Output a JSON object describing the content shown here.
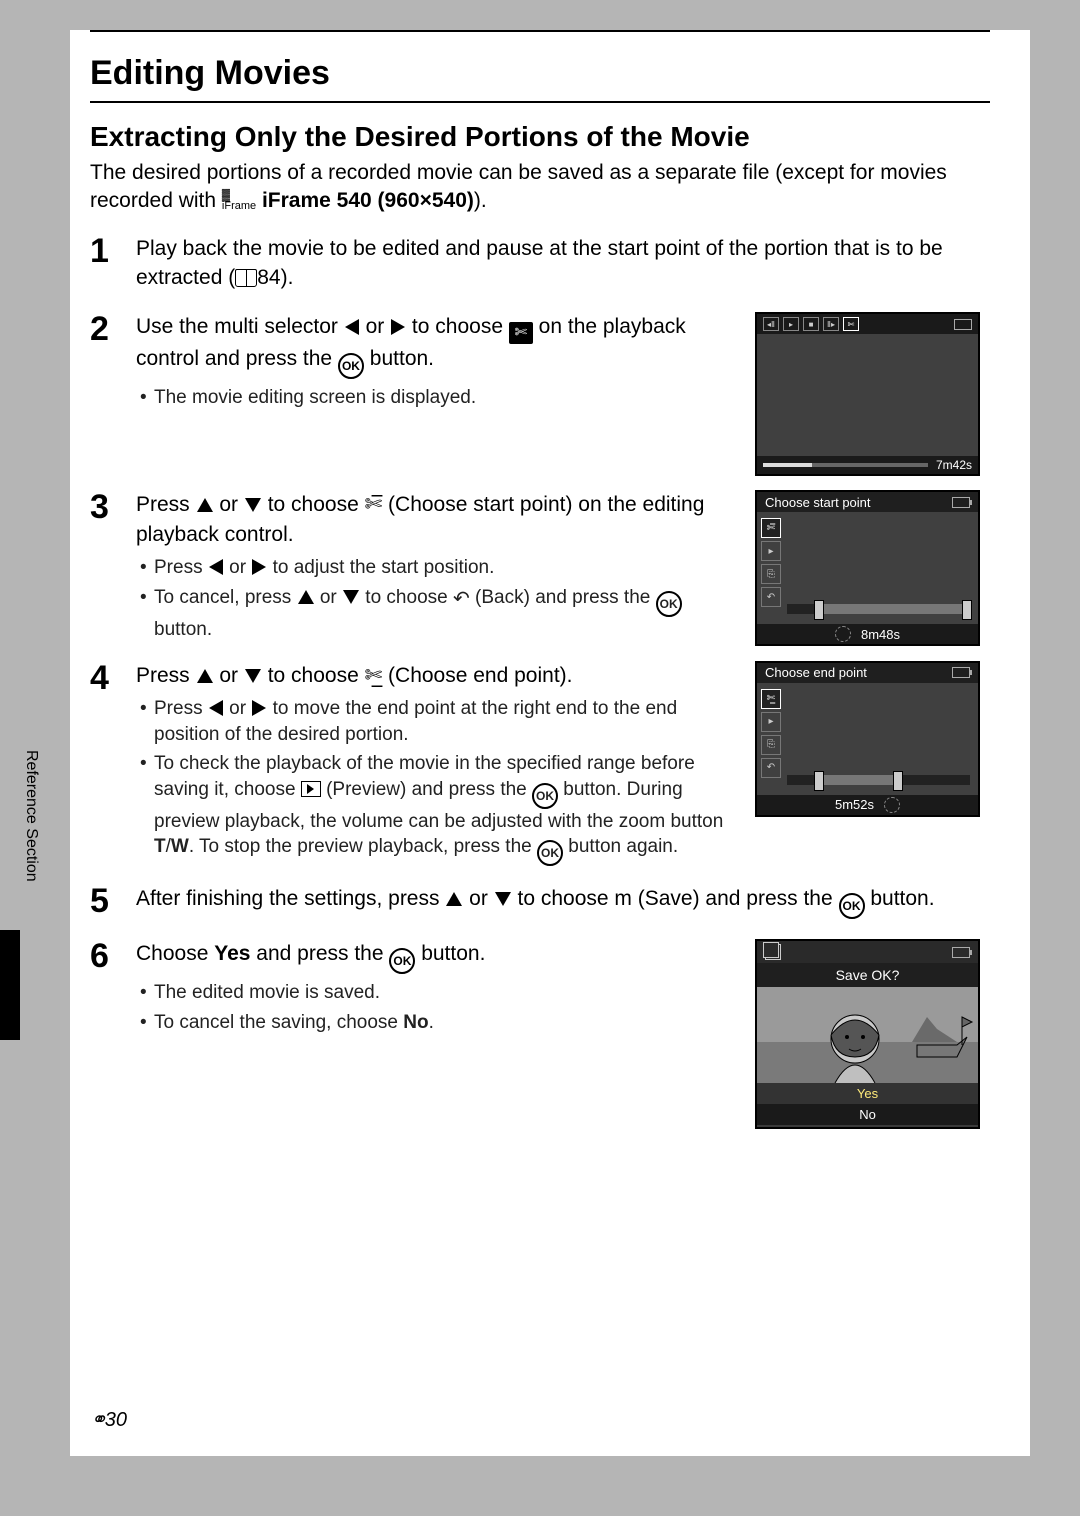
{
  "title": "Editing Movies",
  "subtitle": "Extracting Only the Desired Portions of the Movie",
  "intro_a": "The desired portions of a recorded movie can be saved as a separate file (except for movies recorded with ",
  "intro_b": " iFrame 540 (960×540)",
  "intro_c": ").",
  "steps": {
    "s1": {
      "num": "1",
      "text_a": "Play back the movie to be edited and pause at the start point of the portion that is to be extracted (",
      "ref": "84",
      "text_b": ")."
    },
    "s2": {
      "num": "2",
      "text_a": "Use the multi selector ",
      "text_b": " or ",
      "text_c": " to choose ",
      "text_d": " on the playback control and press the ",
      "text_e": " button.",
      "bullet1": "The movie editing screen is displayed."
    },
    "s3": {
      "num": "3",
      "text_a": "Press ",
      "text_b": " or ",
      "text_c": " to choose ",
      "text_d": " (Choose start point) on the editing playback control.",
      "bullet1_a": "Press ",
      "bullet1_b": " or ",
      "bullet1_c": " to adjust the start position.",
      "bullet2_a": "To cancel, press ",
      "bullet2_b": " or ",
      "bullet2_c": " to choose ",
      "bullet2_d": " (Back) and press the ",
      "bullet2_e": " button."
    },
    "s4": {
      "num": "4",
      "text_a": "Press ",
      "text_b": " or ",
      "text_c": " to choose ",
      "text_d": " (Choose end point).",
      "bullet1_a": "Press ",
      "bullet1_b": " or ",
      "bullet1_c": " to move the end point at the right end to the end position of the desired portion.",
      "bullet2_a": "To check the playback of the movie in the specified range before saving it, choose ",
      "bullet2_b": " (Preview) and press the ",
      "bullet2_c": " button. During preview playback, the volume can be adjusted with the zoom button ",
      "bullet2_d": "T",
      "bullet2_e": "/",
      "bullet2_f": "W",
      "bullet2_g": ". To stop the preview playback, press the ",
      "bullet2_h": " button again."
    },
    "s5": {
      "num": "5",
      "text_a": "After finishing the settings, press ",
      "text_b": " or ",
      "text_c": " to choose m  (Save) and press the ",
      "text_d": " button."
    },
    "s6": {
      "num": "6",
      "text_a": "Choose ",
      "text_b": "Yes",
      "text_c": " and press the ",
      "text_d": " button.",
      "bullet1": "The edited movie is saved.",
      "bullet2_a": "To cancel the saving, choose ",
      "bullet2_b": "No",
      "bullet2_c": "."
    }
  },
  "figures": {
    "fig2": {
      "time": "7m42s"
    },
    "fig3": {
      "header": "Choose start point",
      "time": "8m48s"
    },
    "fig4": {
      "header": "Choose end point",
      "time": "5m52s"
    },
    "fig6": {
      "prompt": "Save OK?",
      "yes": "Yes",
      "no": "No"
    }
  },
  "side_label": "Reference Section",
  "page_number": "30",
  "ok_label": "OK",
  "scissors_glyph": "✄",
  "iframe_label": "iFrame"
}
